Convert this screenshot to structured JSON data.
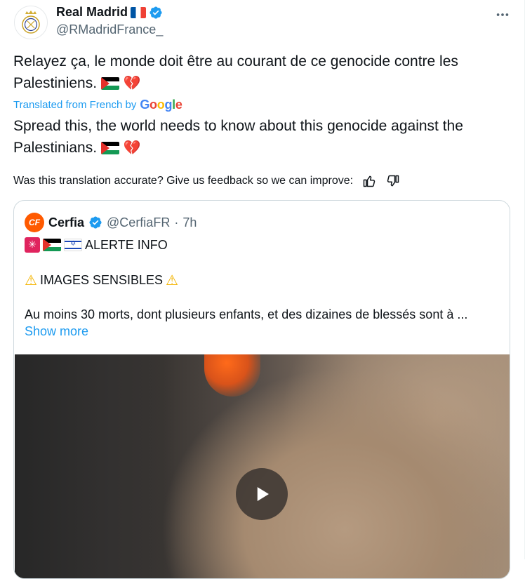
{
  "author": {
    "name": "Real Madrid",
    "handle": "@RMadridFrance_",
    "verified_color": "#1d9bf0"
  },
  "tweet": {
    "original_text_line1": "Relayez ça, le monde doit être au courant de ce genocide contre les",
    "original_text_line2": "Palestiniens.",
    "translated_from": "Translated from French by",
    "translator": "Google",
    "translated_text_line1": "Spread this, the world needs to know about this genocide against the",
    "translated_text_line2": "Palestinians.",
    "feedback_prompt": "Was this translation accurate? Give us feedback so we can improve:"
  },
  "quote": {
    "name": "Cerfia",
    "handle": "@CerfiaFR",
    "separator": "·",
    "time": "7h",
    "alert": "ALERTE INFO",
    "warning": "IMAGES SENSIBLES",
    "body": "Au moins 30 morts, dont plusieurs enfants, et des dizaines de blessés sont à ...",
    "show_more": "Show more"
  },
  "icons": {
    "more": "more-horizontal-icon",
    "thumbs_up": "thumbs-up-icon",
    "thumbs_down": "thumbs-down-icon",
    "play": "play-icon"
  }
}
